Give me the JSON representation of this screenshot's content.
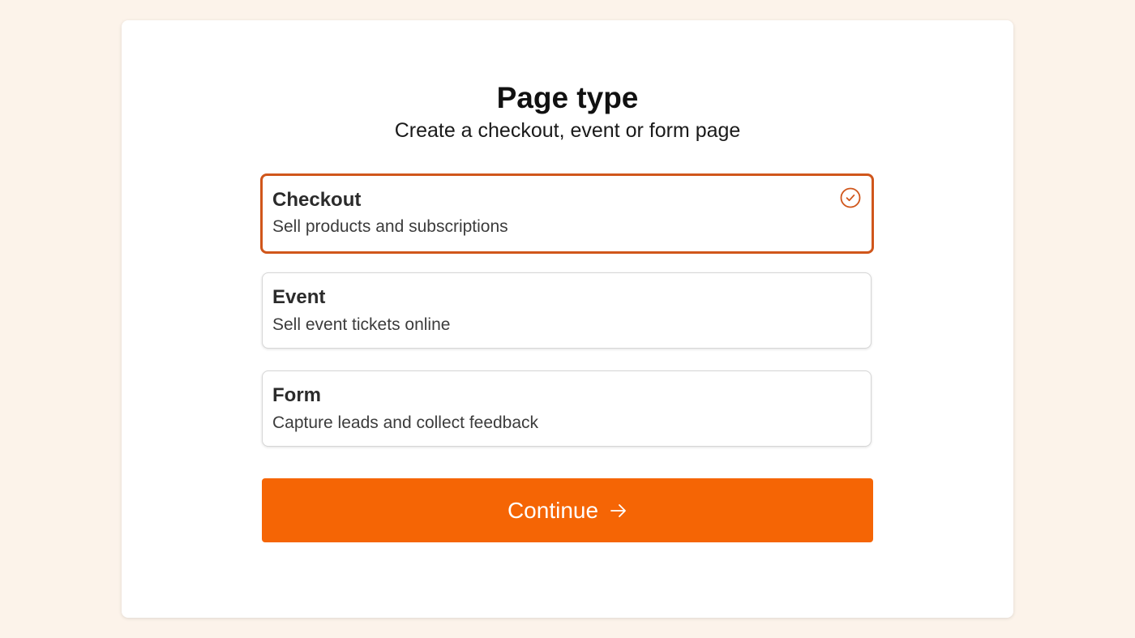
{
  "header": {
    "title": "Page type",
    "subtitle": "Create a checkout, event or form page"
  },
  "options": [
    {
      "title": "Checkout",
      "description": "Sell products and subscriptions",
      "selected": true,
      "icon": "check-circle-icon"
    },
    {
      "title": "Event",
      "description": "Sell event tickets online",
      "selected": false
    },
    {
      "title": "Form",
      "description": "Capture leads and collect feedback",
      "selected": false
    }
  ],
  "actions": {
    "continue_label": "Continue",
    "continue_icon": "arrow-right-icon"
  },
  "colors": {
    "background": "#fcf3ea",
    "accent": "#f56505",
    "selected_border": "#d0561b"
  }
}
